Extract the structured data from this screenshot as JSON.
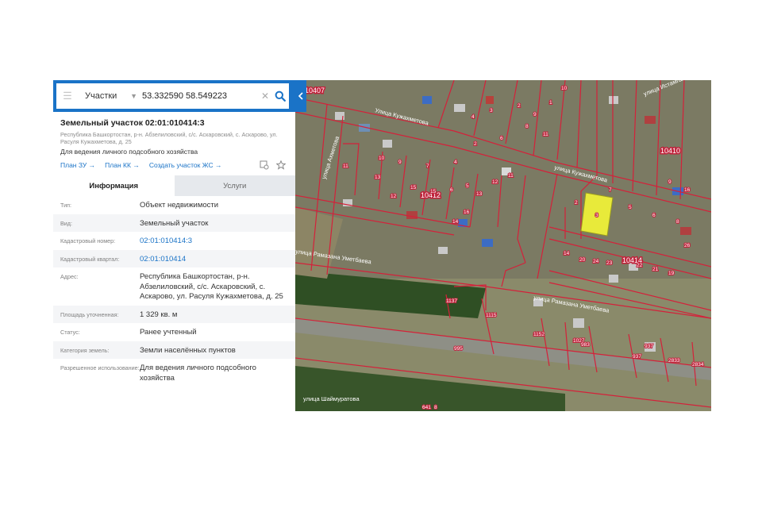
{
  "search": {
    "layer": "Участки",
    "query": "53.332590 58.549223"
  },
  "parcel": {
    "title": "Земельный участок 02:01:010414:3",
    "address_short": "Республика Башкортостан, р-н. Абзелиловский, с/с. Аскаровский, с. Аскарово, ул. Расуля Кужахметова, д. 25",
    "purpose": "Для ведения личного подсобного хозяйства"
  },
  "links": {
    "plan_zu": "План ЗУ",
    "plan_kk": "План КК",
    "create": "Создать участок ЖС"
  },
  "tabs": {
    "info": "Информация",
    "services": "Услуги"
  },
  "rows": [
    {
      "label": "Тип:",
      "value": "Объект недвижимости",
      "link": false
    },
    {
      "label": "Вид:",
      "value": "Земельный участок",
      "link": false
    },
    {
      "label": "Кадастровый номер:",
      "value": "02:01:010414:3",
      "link": true
    },
    {
      "label": "Кадастровый квартал:",
      "value": "02:01:010414",
      "link": true
    },
    {
      "label": "Адрес:",
      "value": "Республика Башкортостан, р-н. Абзелиловский, с/с. Аскаровский, с. Аскарово, ул. Расуля Кужахметова, д. 25",
      "link": false
    },
    {
      "label": "Площадь уточненная:",
      "value": "1 329 кв. м",
      "link": false
    },
    {
      "label": "Статус:",
      "value": "Ранее учтенный",
      "link": false
    },
    {
      "label": "Категория земель:",
      "value": "Земли населённых пунктов",
      "link": false
    },
    {
      "label": "Разрешенное использование:",
      "value": "Для ведения личного подсобного хозяйства",
      "link": false
    }
  ],
  "map": {
    "streets": {
      "s1": "Улица Кужахметова",
      "s2": "улица Кужахметова",
      "s3": "улица Ахметова",
      "s4": "улица Рамазана Уметбаева",
      "s5": "улица Рамазана Уметбаева",
      "s6": "улица Шаймуратова",
      "s7": "улица Истамгалина"
    },
    "quarters": {
      "q1": "10407",
      "q2": "10412",
      "q3": "10410",
      "q4": "10414"
    },
    "selected_parcel": "3",
    "parcel_numbers": [
      "10",
      "1",
      "9",
      "11",
      "2",
      "3",
      "4",
      "2",
      "6",
      "8",
      "13",
      "12",
      "15",
      "15",
      "6",
      "5",
      "4",
      "7",
      "9",
      "10",
      "11",
      "14",
      "16",
      "13",
      "12",
      "11",
      "2",
      "5",
      "6",
      "8",
      "7",
      "9",
      "14",
      "20",
      "24",
      "23",
      "22",
      "21",
      "19",
      "26",
      "1137",
      "1115",
      "1152",
      "1027",
      "983",
      "937",
      "937",
      "2833",
      "2834",
      "995",
      "641",
      "8",
      "16"
    ],
    "selected_color": "#e8ea3a",
    "boundary_color": "#d4213a"
  }
}
